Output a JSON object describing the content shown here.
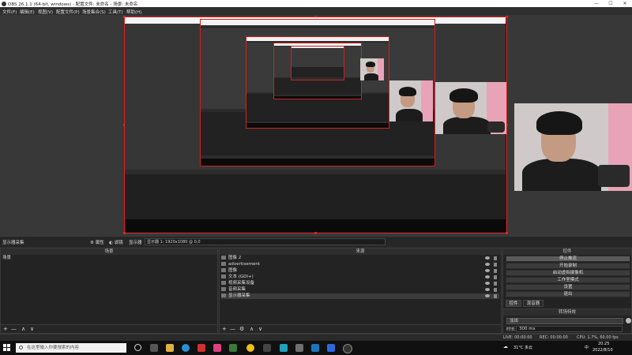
{
  "window": {
    "title": "OBS 26.1.1 (64-bit, windows) - 配置文件: 未命名 - 场景: 未命名",
    "minimize": "—",
    "maximize": "☐",
    "close": "✕"
  },
  "menu": {
    "items": [
      "文件(F)",
      "编辑(E)",
      "视图(V)",
      "配置文件(P)",
      "场景集合(S)",
      "工具(T)",
      "帮助(H)"
    ]
  },
  "source_toolbar": {
    "source_name": "显示器采集",
    "properties": "属性",
    "filters": "滤镜",
    "display_label": "显示器",
    "display_value": "显示器 1: 1920x1080 @ 0,0"
  },
  "scenes": {
    "header": "场景",
    "items": [
      "场景"
    ],
    "footer": {
      "add": "+",
      "remove": "—",
      "up": "∧",
      "down": "∨"
    }
  },
  "sources": {
    "header": "来源",
    "items": [
      "图像 2",
      "advertisement",
      "图像",
      "文本 (GDI+)",
      "视频采集设备",
      "音频采集",
      "显示器采集"
    ],
    "footer": {
      "add": "+",
      "remove": "—",
      "gear": "⚙",
      "up": "∧",
      "down": "∨"
    }
  },
  "controls": {
    "header": "控件",
    "buttons": [
      "停止推流",
      "开始录制",
      "启动虚拟摄像机",
      "工作室模式",
      "设置",
      "退出"
    ]
  },
  "dock_tabs": {
    "tab1": "控件",
    "tab2": "混音器"
  },
  "transitions": {
    "header": "转场特效",
    "selected": "淡出",
    "duration_label": "时长",
    "duration_value": "300 ms"
  },
  "status": {
    "live": "LIVE: 00:00:00",
    "rec": "REC: 00:00:00",
    "cpu": "CPU: 1.7%, 60.00 fps"
  },
  "taskbar": {
    "search_placeholder": "在这里输入你要搜索的内容",
    "weather": "31°C 多云",
    "time": "20:25",
    "date": "2022/8/10",
    "ime": "中"
  },
  "colors": {
    "accent_red": "#e02020",
    "pink_wall": "#e9a3b8"
  }
}
